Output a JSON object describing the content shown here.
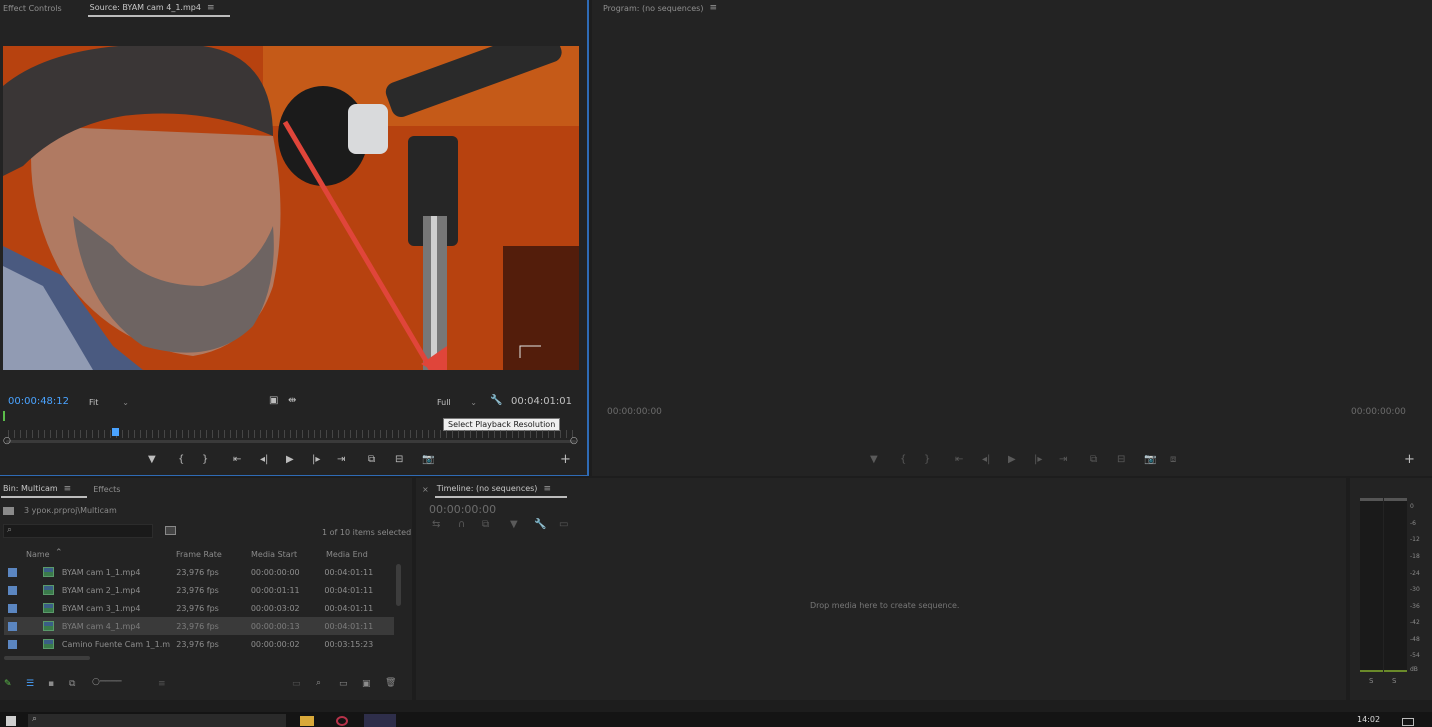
{
  "source_panel": {
    "tabs": [
      "Effect Controls",
      "Source: BYAM cam 4_1.mp4"
    ],
    "menu_glyph": "≡",
    "current_timecode": "00:00:48:12",
    "zoom": "Fit",
    "resolution": "Full",
    "duration_timecode": "00:04:01:01",
    "tooltip": "Select Playback Resolution"
  },
  "program_panel": {
    "title": "Program: (no sequences)",
    "timecode_left": "00:00:00:00",
    "timecode_right": "00:00:00:00"
  },
  "bin_panel": {
    "tabs": [
      "Bin: Multicam",
      "Effects"
    ],
    "path": "3 урок.prproj\\Multicam",
    "items_status": "1 of 10 items selected",
    "columns": [
      "Name",
      "Frame Rate",
      "Media Start",
      "Media End"
    ],
    "rows": [
      {
        "name": "BYAM cam 1_1.mp4",
        "fps": "23,976 fps",
        "start": "00:00:00:00",
        "end": "00:04:01:11"
      },
      {
        "name": "BYAM cam 2_1.mp4",
        "fps": "23,976 fps",
        "start": "00:00:01:11",
        "end": "00:04:01:11"
      },
      {
        "name": "BYAM cam 3_1.mp4",
        "fps": "23,976 fps",
        "start": "00:00:03:02",
        "end": "00:04:01:11"
      },
      {
        "name": "BYAM cam 4_1.mp4",
        "fps": "23,976 fps",
        "start": "00:00:00:13",
        "end": "00:04:01:11"
      },
      {
        "name": "Camino Fuente Cam 1_1.m",
        "fps": "23,976 fps",
        "start": "00:00:00:02",
        "end": "00:03:15:23"
      }
    ]
  },
  "timeline_panel": {
    "title": "Timeline: (no sequences)",
    "timecode": "00:00:00:00",
    "drop_hint": "Drop media here to create sequence."
  },
  "audio_meter": {
    "scale": [
      "0",
      "-6",
      "-12",
      "-18",
      "-24",
      "-30",
      "-36",
      "-42",
      "-48",
      "-54",
      "dB"
    ],
    "solo_labels": [
      "S",
      "S"
    ]
  },
  "taskbar": {
    "clock": "14:02"
  },
  "colors": {
    "accent_blue": "#4aa3ff",
    "arrow_red": "#e0453a",
    "swatch_blue": "#5b86c1"
  }
}
